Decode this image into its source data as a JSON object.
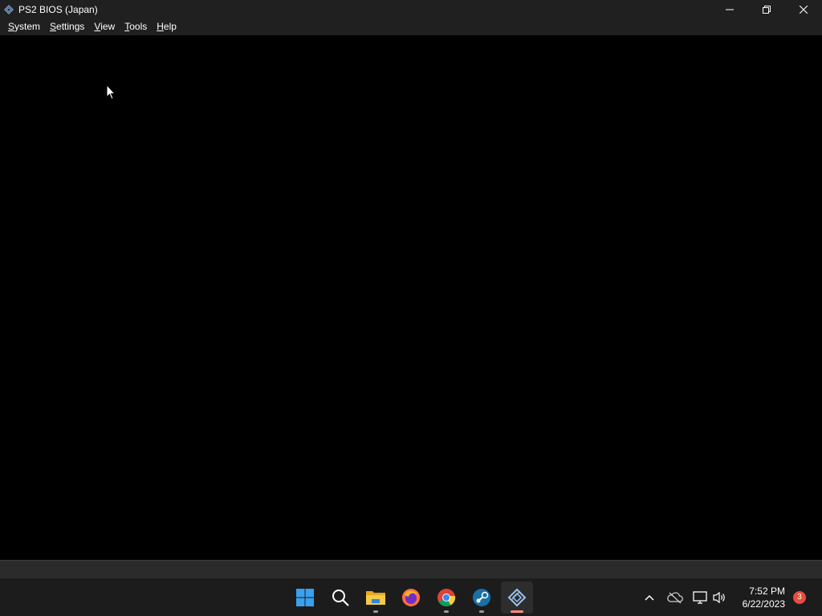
{
  "window": {
    "title": "PS2 BIOS (Japan)",
    "app_icon": "pcsx2-icon",
    "controls": [
      "minimize-icon",
      "restore-icon",
      "close-icon"
    ]
  },
  "menu": {
    "items": [
      {
        "label": "System",
        "accel": "S",
        "rest": "ystem"
      },
      {
        "label": "Settings",
        "accel": "S",
        "rest": "ettings"
      },
      {
        "label": "View",
        "accel": "V",
        "rest": "iew"
      },
      {
        "label": "Tools",
        "accel": "T",
        "rest": "ools"
      },
      {
        "label": "Help",
        "accel": "H",
        "rest": "elp"
      }
    ]
  },
  "taskbar": {
    "apps": [
      {
        "name": "start-icon",
        "running": false
      },
      {
        "name": "search-icon",
        "running": false
      },
      {
        "name": "file-explorer-icon",
        "running": true
      },
      {
        "name": "firefox-icon",
        "running": false
      },
      {
        "name": "chrome-icon",
        "running": true
      },
      {
        "name": "steam-icon",
        "running": true
      },
      {
        "name": "pcsx2-icon",
        "running": true,
        "active": true
      }
    ],
    "tray": [
      "chevron-up-icon",
      "cloud-offline-icon",
      "network-icon",
      "volume-icon"
    ],
    "time": "7:52 PM",
    "date": "6/22/2023",
    "notification_count": "3"
  },
  "colors": {
    "titlebar": "#202020",
    "display": "#000000",
    "statusbar": "#2b2b2b",
    "taskbar": "#1c1c1c",
    "active_indicator": "#ff8a80",
    "notification_badge": "#e74c3c"
  }
}
